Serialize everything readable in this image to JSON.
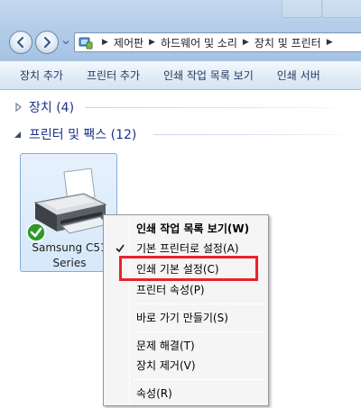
{
  "titlebar": {
    "ghost_title": "",
    "back_icon": "back-arrow-icon",
    "forward_icon": "forward-arrow-icon"
  },
  "address": {
    "breadcrumbs": [
      "제어판",
      "하드웨어 및 소리",
      "장치 및 프린터"
    ],
    "icon": "control-panel-icon"
  },
  "toolbar": {
    "items": [
      "장치 추가",
      "프린터 추가",
      "인쇄 작업 목록 보기",
      "인쇄 서버"
    ]
  },
  "groups": {
    "devices": {
      "label": "장치 (4)",
      "expanded": false
    },
    "printers": {
      "label": "프린터 및 팩스 (12)",
      "expanded": true
    }
  },
  "device": {
    "name_line1": "Samsung C51",
    "name_line2": "Series",
    "status_icon": "default-printer-check-icon",
    "selected": true
  },
  "context_menu": {
    "items": [
      {
        "label": "인쇄 작업 목록 보기(W)",
        "bold": true
      },
      {
        "label": "기본 프린터로 설정(A)",
        "checked": true
      },
      {
        "label": "인쇄 기본 설정(C)",
        "highlighted": true
      },
      {
        "label": "프린터 속성(P)"
      },
      {
        "label": "바로 가기 만들기(S)"
      },
      {
        "label": "문제 해결(T)"
      },
      {
        "label": "장치 제거(V)"
      },
      {
        "label": "속성(R)"
      }
    ]
  },
  "colors": {
    "highlight_box": "#e8232b",
    "group_header": "#1e3287",
    "tile_border": "#84acdd"
  }
}
